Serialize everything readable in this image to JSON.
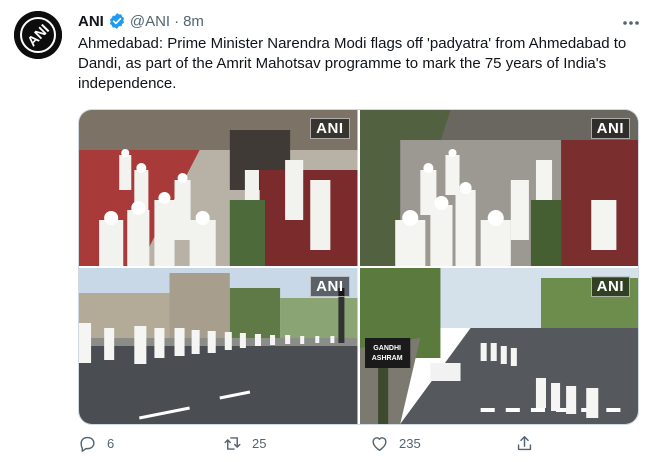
{
  "tweet": {
    "author_name": "ANI",
    "handle": "@ANI",
    "separator": "·",
    "time": "8m",
    "text": "Ahmedabad: Prime Minister Narendra Modi flags off 'padyatra' from Ahmedabad to Dandi, as part of the Amrit Mahotsav programme to mark the 75 years of India's independence.",
    "avatar_icon": "ani-logo-icon",
    "verified_color": "#1d9bf0"
  },
  "media": {
    "watermark": "ANI",
    "sign_line1": "GANDHI",
    "sign_line2": "ASHRAM"
  },
  "actions": {
    "reply_count": "6",
    "retweet_count": "25",
    "like_count": "235"
  },
  "colors": {
    "text": "#0f1419",
    "secondary": "#536471",
    "border": "#cfd9de"
  }
}
